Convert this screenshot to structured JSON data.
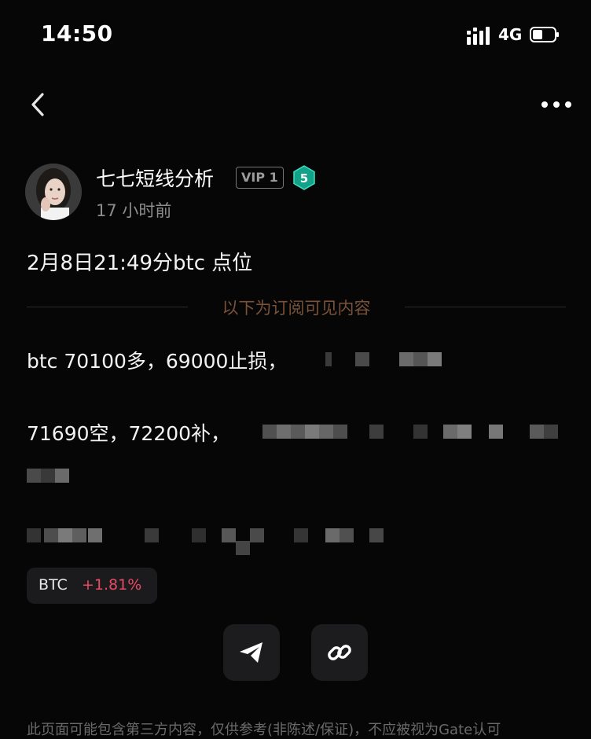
{
  "status_bar": {
    "time": "14:50",
    "network": "4G"
  },
  "nav": {
    "back_icon": "chevron-left-icon",
    "more_icon": "more-horizontal-icon"
  },
  "author": {
    "name": "七七短线分析",
    "vip": "VIP 1",
    "level": "5",
    "time_ago": "17 小时前"
  },
  "post": {
    "title": "2月8日21:49分btc 点位",
    "divider": "以下为订阅可见内容",
    "line1": "btc 70100多，69000止损，",
    "line2": "71690空，72200补，"
  },
  "ticker": {
    "symbol": "BTC",
    "change": "+1.81%",
    "change_color": "#e84a66"
  },
  "actions": {
    "share_icon": "send-icon",
    "link_icon": "link-icon"
  },
  "disclaimer": "此页面可能包含第三方内容，仅供参考(非陈述/保证)，不应被视为Gate认可"
}
